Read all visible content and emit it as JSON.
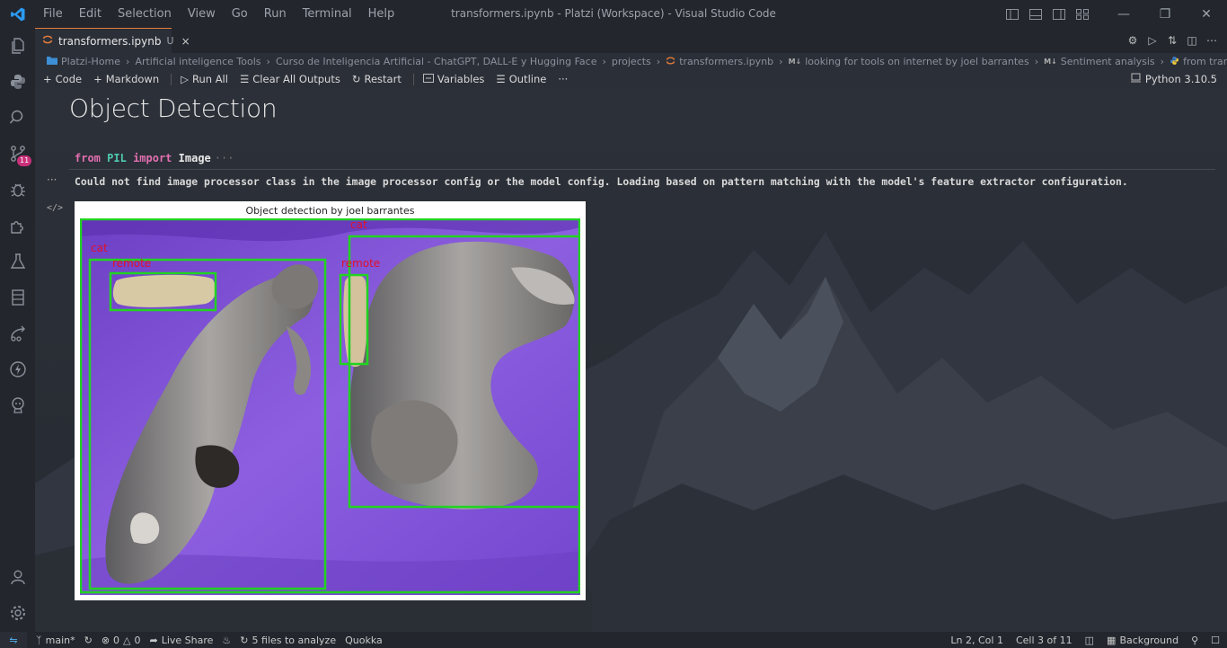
{
  "app": {
    "window_title": "transformers.ipynb - Platzi (Workspace) - Visual Studio Code",
    "menu": [
      "File",
      "Edit",
      "Selection",
      "View",
      "Go",
      "Run",
      "Terminal",
      "Help"
    ]
  },
  "activity_bar": {
    "badge_count": "11",
    "items": [
      "explorer-icon",
      "python-icon",
      "search-icon",
      "source-control-icon",
      "run-debug-icon",
      "extensions-icon",
      "testing-icon",
      "notebook-icon",
      "remote-explorer-icon",
      "thunder-icon",
      "ai-icon",
      "account-icon",
      "settings-gear-icon"
    ]
  },
  "tab": {
    "label": "transformers.ipynb",
    "modified_marker": "U",
    "close": "×"
  },
  "breadcrumb": [
    "Platzi-Home",
    "Artificial inteligence Tools",
    "Curso de Inteligencia Artificial - ChatGPT, DALL-E y Hugging Face",
    "projects",
    "transformers.ipynb",
    "looking for tools on internet by joel barrantes",
    "Sentiment analysis",
    "from transformers import pipeline"
  ],
  "toolbar": {
    "code": "Code",
    "markdown": "Markdown",
    "run_all": "Run All",
    "clear_outputs": "Clear All Outputs",
    "restart": "Restart",
    "variables": "Variables",
    "outline": "Outline",
    "more": "···",
    "kernel": "Python 3.10.5"
  },
  "notebook": {
    "heading": "Object Detection",
    "code": {
      "kw_from": "from",
      "module": "PIL",
      "kw_import": "import",
      "name": "Image",
      "ellipsis": "···"
    },
    "output_dots": "···",
    "output_text": "Could not find image processor class in the image processor config or the model config. Loading based on pattern matching with the model's feature extractor configuration.",
    "figure_title": "Object detection by joel barrantes",
    "detections": [
      "cat",
      "remote",
      "cat",
      "remote"
    ]
  },
  "statusbar": {
    "branch": "main*",
    "errors": "0",
    "warnings": "0",
    "live_share": "Live Share",
    "analyze": "5 files to analyze",
    "quokka": "Quokka",
    "position": "Ln 2, Col 1",
    "cell": "Cell 3 of 11",
    "background": "Background"
  },
  "colors": {
    "accent_tab": "#e07b39",
    "keyword": "#e36fb0",
    "module": "#4ec9b0",
    "box": "#21d321",
    "box_label": "#e0102a",
    "blanket": "#7b46c9"
  }
}
